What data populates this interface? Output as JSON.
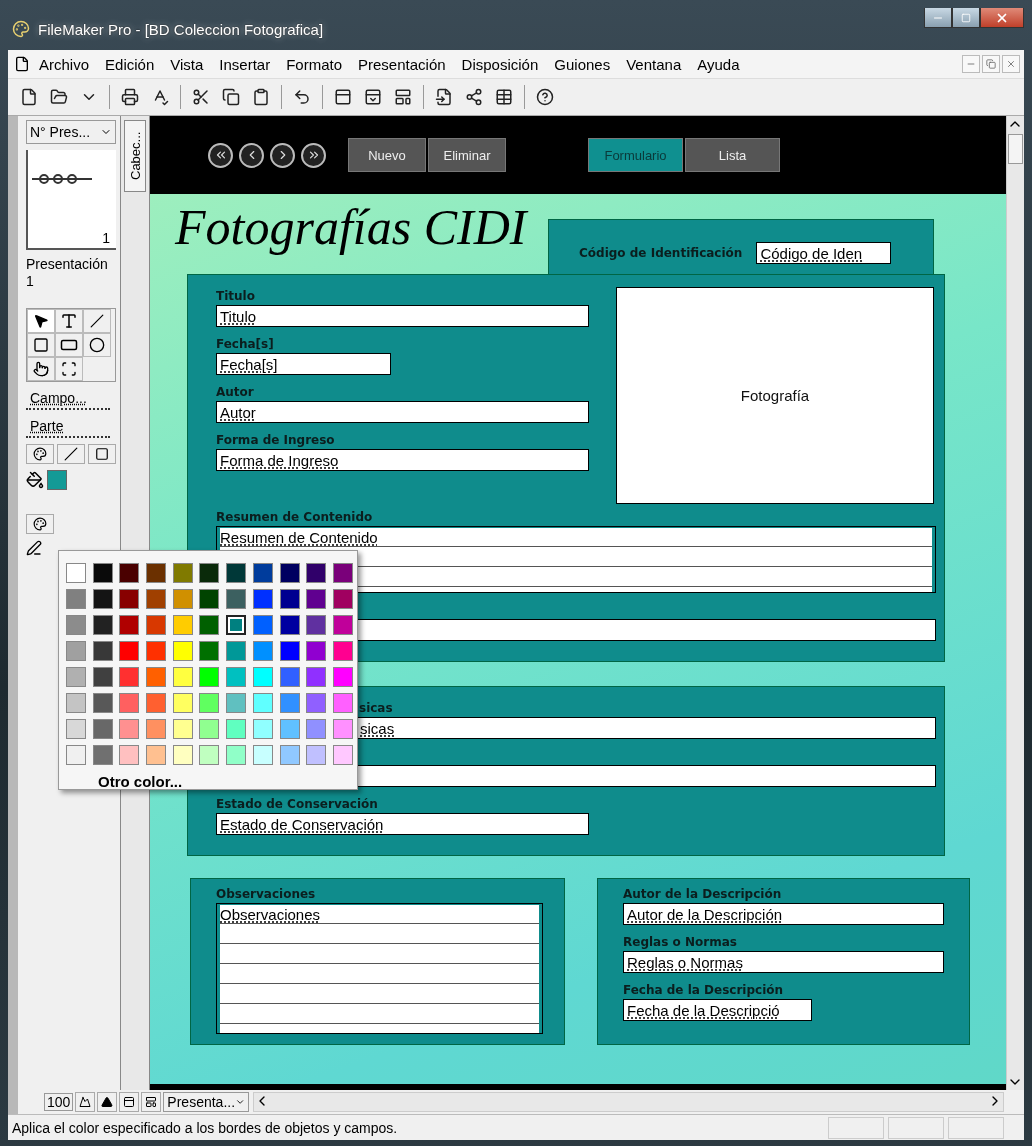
{
  "window": {
    "title": "FileMaker Pro - [BD Coleccion Fotografica]"
  },
  "menu": [
    "Archivo",
    "Edición",
    "Vista",
    "Insertar",
    "Formato",
    "Presentación",
    "Disposición",
    "Guiones",
    "Ventana",
    "Ayuda"
  ],
  "layout_panel": {
    "layout_menu": "N° Pres...",
    "page_number": "1",
    "layout_name": "Presentación 1",
    "field_tool": "Campo...",
    "part_tool": "Parte"
  },
  "part_tab": "Cabec...",
  "header": {
    "buttons": [
      {
        "label": "Nuevo"
      },
      {
        "label": "Eliminar"
      }
    ],
    "tabs": [
      {
        "label": "Formulario",
        "selected": true
      },
      {
        "label": "Lista",
        "selected": false
      }
    ]
  },
  "form": {
    "title": "Fotografías CIDI",
    "code": {
      "label": "Código de Identificación",
      "value": "Código de Iden"
    },
    "photo": "Fotografía",
    "left_fields": [
      {
        "label": "Titulo",
        "value": "Titulo",
        "kind": "long"
      },
      {
        "label": "Fecha[s]",
        "value": "Fecha[s]",
        "kind": "short"
      },
      {
        "label": "Autor",
        "value": "Autor",
        "kind": "long"
      },
      {
        "label": "Forma de Ingreso",
        "value": "Forma de Ingreso",
        "kind": "long"
      }
    ],
    "main_fields": [
      {
        "label": "Resumen de Contenido",
        "value": "Resumen de Contenido",
        "kind": "memo",
        "covered": false
      },
      {
        "kind": "wide"
      }
    ],
    "second_fields": [
      {
        "label": "sicas",
        "value": "sicas",
        "kind": "wide",
        "covered": true
      },
      {
        "kind": "wide"
      },
      {
        "label": "Estado de Conservación",
        "value": "Estado de Conservación",
        "kind": "long",
        "covered": false
      }
    ],
    "notes": {
      "label": "Observaciones",
      "value": "Observaciones"
    },
    "description_fields": [
      {
        "label": "Autor de la Descripción",
        "value": "Autor de la Descripción",
        "kind": "long"
      },
      {
        "label": "Reglas o Normas",
        "value": "Reglas o Normas",
        "kind": "long"
      },
      {
        "label": "Fecha de la Descripción",
        "value": "Fecha de la Descripció",
        "kind": "short"
      }
    ]
  },
  "palette": {
    "swatches": [
      {
        "color": "#ffffff",
        "selected": false
      },
      {
        "color": "#0a0a0a",
        "selected": false
      },
      {
        "color": "#4a0000",
        "selected": false
      },
      {
        "color": "#6b3000",
        "selected": false
      },
      {
        "color": "#807a00",
        "selected": false
      },
      {
        "color": "#0a2a0a",
        "selected": false
      },
      {
        "color": "#003838",
        "selected": false
      },
      {
        "color": "#003c9c",
        "selected": false
      },
      {
        "color": "#000060",
        "selected": false
      },
      {
        "color": "#30006a",
        "selected": false
      },
      {
        "color": "#7a007a",
        "selected": false
      },
      {
        "color": "#808080",
        "selected": false
      },
      {
        "color": "#141414",
        "selected": false
      },
      {
        "color": "#880000",
        "selected": false
      },
      {
        "color": "#a04000",
        "selected": false
      },
      {
        "color": "#d09000",
        "selected": false
      },
      {
        "color": "#004400",
        "selected": false
      },
      {
        "color": "#3c6060",
        "selected": false
      },
      {
        "color": "#0030ff",
        "selected": false
      },
      {
        "color": "#000090",
        "selected": false
      },
      {
        "color": "#600090",
        "selected": false
      },
      {
        "color": "#a00060",
        "selected": false
      },
      {
        "color": "#8c8c8c",
        "selected": false
      },
      {
        "color": "#222222",
        "selected": false
      },
      {
        "color": "#b00000",
        "selected": false
      },
      {
        "color": "#d83800",
        "selected": false
      },
      {
        "color": "#ffcc00",
        "selected": false
      },
      {
        "color": "#006000",
        "selected": false
      },
      {
        "color": "#008080",
        "selected": true
      },
      {
        "color": "#0060ff",
        "selected": false
      },
      {
        "color": "#0000a0",
        "selected": false
      },
      {
        "color": "#6030a0",
        "selected": false
      },
      {
        "color": "#c0009a",
        "selected": false
      },
      {
        "color": "#a0a0a0",
        "selected": false
      },
      {
        "color": "#383838",
        "selected": false
      },
      {
        "color": "#ff0000",
        "selected": false
      },
      {
        "color": "#ff3000",
        "selected": false
      },
      {
        "color": "#ffff00",
        "selected": false
      },
      {
        "color": "#007000",
        "selected": false
      },
      {
        "color": "#009898",
        "selected": false
      },
      {
        "color": "#0090ff",
        "selected": false
      },
      {
        "color": "#0000ff",
        "selected": false
      },
      {
        "color": "#9000d0",
        "selected": false
      },
      {
        "color": "#ff0090",
        "selected": false
      },
      {
        "color": "#b0b0b0",
        "selected": false
      },
      {
        "color": "#404040",
        "selected": false
      },
      {
        "color": "#ff3030",
        "selected": false
      },
      {
        "color": "#ff6000",
        "selected": false
      },
      {
        "color": "#ffff40",
        "selected": false
      },
      {
        "color": "#00ff00",
        "selected": false
      },
      {
        "color": "#00c0c0",
        "selected": false
      },
      {
        "color": "#00ffff",
        "selected": false
      },
      {
        "color": "#3060ff",
        "selected": false
      },
      {
        "color": "#9030ff",
        "selected": false
      },
      {
        "color": "#ff00ff",
        "selected": false
      },
      {
        "color": "#c4c4c4",
        "selected": false
      },
      {
        "color": "#585858",
        "selected": false
      },
      {
        "color": "#ff6060",
        "selected": false
      },
      {
        "color": "#ff6030",
        "selected": false
      },
      {
        "color": "#ffff60",
        "selected": false
      },
      {
        "color": "#60ff60",
        "selected": false
      },
      {
        "color": "#60c0c0",
        "selected": false
      },
      {
        "color": "#60ffff",
        "selected": false
      },
      {
        "color": "#3090ff",
        "selected": false
      },
      {
        "color": "#9060ff",
        "selected": false
      },
      {
        "color": "#ff60ff",
        "selected": false
      },
      {
        "color": "#d8d8d8",
        "selected": false
      },
      {
        "color": "#686868",
        "selected": false
      },
      {
        "color": "#ff9090",
        "selected": false
      },
      {
        "color": "#ff9060",
        "selected": false
      },
      {
        "color": "#ffff90",
        "selected": false
      },
      {
        "color": "#90ff90",
        "selected": false
      },
      {
        "color": "#60ffc0",
        "selected": false
      },
      {
        "color": "#90ffff",
        "selected": false
      },
      {
        "color": "#60c0ff",
        "selected": false
      },
      {
        "color": "#9090ff",
        "selected": false
      },
      {
        "color": "#ff90ff",
        "selected": false
      },
      {
        "color": "#f0f0f0",
        "selected": false
      },
      {
        "color": "#707070",
        "selected": false
      },
      {
        "color": "#ffc0c0",
        "selected": false
      },
      {
        "color": "#ffc090",
        "selected": false
      },
      {
        "color": "#ffffc0",
        "selected": false
      },
      {
        "color": "#c0ffc0",
        "selected": false
      },
      {
        "color": "#90ffc8",
        "selected": false
      },
      {
        "color": "#c8ffff",
        "selected": false
      },
      {
        "color": "#90c8ff",
        "selected": false
      },
      {
        "color": "#c0c0ff",
        "selected": false
      },
      {
        "color": "#ffc8ff",
        "selected": false
      }
    ],
    "more": "Otro color..."
  },
  "bottom_bar": {
    "zoom": "100",
    "layout_menu": "Presenta..."
  },
  "status_bar": "Aplica el color especificado a los bordes de objetos y campos."
}
